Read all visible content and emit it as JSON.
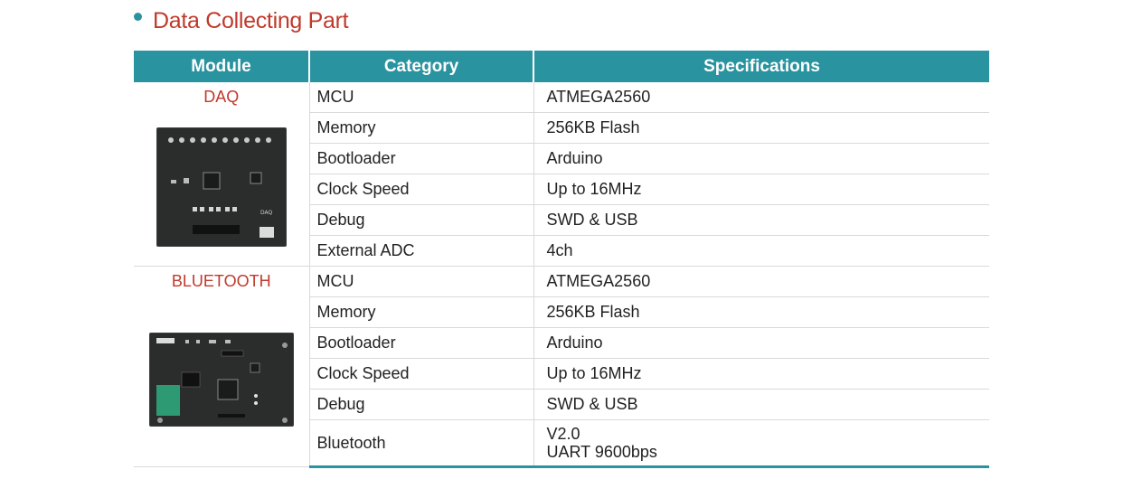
{
  "section": {
    "title": "Data Collecting Part"
  },
  "table": {
    "headers": [
      "Module",
      "Category",
      "Specifications"
    ],
    "modules": [
      {
        "name": "DAQ",
        "image_label": "DAQ",
        "rows": [
          {
            "category": "MCU",
            "value": "ATMEGA2560"
          },
          {
            "category": "Memory",
            "value": "256KB Flash"
          },
          {
            "category": "Bootloader",
            "value": "Arduino"
          },
          {
            "category": "Clock Speed",
            "value": "Up to 16MHz"
          },
          {
            "category": "Debug",
            "value": "SWD & USB"
          },
          {
            "category": "External ADC",
            "value": "4ch"
          }
        ]
      },
      {
        "name": "BLUETOOTH",
        "rows": [
          {
            "category": "MCU",
            "value": "ATMEGA2560"
          },
          {
            "category": "Memory",
            "value": "256KB Flash"
          },
          {
            "category": "Bootloader",
            "value": "Arduino"
          },
          {
            "category": "Clock Speed",
            "value": "Up to 16MHz"
          },
          {
            "category": "Debug",
            "value": "SWD & USB"
          },
          {
            "category": "Bluetooth",
            "value_lines": [
              "V2.0",
              "UART 9600bps"
            ]
          }
        ]
      }
    ]
  },
  "colors": {
    "accent": "#2a93a0",
    "title": "#c0392b",
    "module_name": "#c0392b",
    "board": "#2b2d2d"
  }
}
